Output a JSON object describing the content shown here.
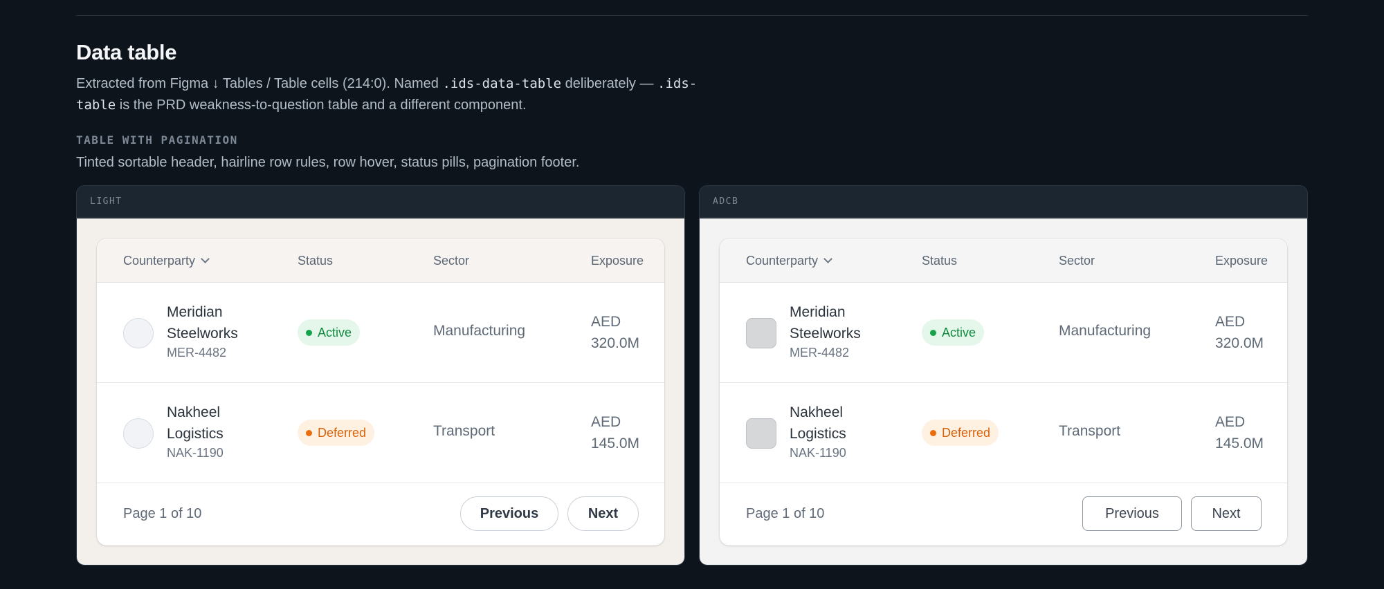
{
  "page": {
    "title": "Data table",
    "description": {
      "part1": "Extracted from Figma ↓ Tables / Table cells (214:0). Named ",
      "code1": ".ids-data-table",
      "part2": " deliberately — ",
      "code2": ".ids-table",
      "part3": " is the PRD weakness-to-question table and a different component."
    },
    "section_label": "TABLE WITH PAGINATION",
    "section_desc": "Tinted sortable header, hairline row rules, row hover, status pills, pagination footer."
  },
  "frames": [
    {
      "label": "LIGHT",
      "table": {
        "columns": [
          "Counterparty",
          "Status",
          "Sector",
          "Exposure"
        ],
        "rows": [
          {
            "name": "Meridian Steelworks",
            "id": "MER-4482",
            "status": "Active",
            "status_color": "#16a34a",
            "sector": "Manufacturing",
            "exposure": "AED 320.0M"
          },
          {
            "name": "Nakheel Logistics",
            "id": "NAK-1190",
            "status": "Deferred",
            "status_color": "#ea6c0a",
            "sector": "Transport",
            "exposure": "AED 145.0M"
          }
        ],
        "pagination": {
          "label": "Page 1 of 10",
          "previous": "Previous",
          "next": "Next"
        }
      }
    },
    {
      "label": "ADCB",
      "table": {
        "columns": [
          "Counterparty",
          "Status",
          "Sector",
          "Exposure"
        ],
        "rows": [
          {
            "name": "Meridian Steelworks",
            "id": "MER-4482",
            "status": "Active",
            "status_color": "#16a34a",
            "sector": "Manufacturing",
            "exposure": "AED 320.0M"
          },
          {
            "name": "Nakheel Logistics",
            "id": "NAK-1190",
            "status": "Deferred",
            "status_color": "#ea6c0a",
            "sector": "Transport",
            "exposure": "AED 145.0M"
          }
        ],
        "pagination": {
          "label": "Page 1 of 10",
          "previous": "Previous",
          "next": "Next"
        }
      }
    }
  ],
  "icons": {
    "sort": "chevron-down-icon"
  },
  "colors": {
    "background": "#0d141b",
    "active": "#16a34a",
    "deferred": "#ea6c0a"
  }
}
